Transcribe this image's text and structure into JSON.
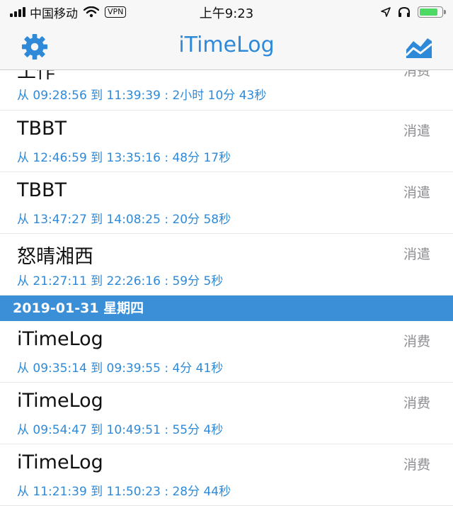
{
  "status_bar": {
    "carrier": "中国移动",
    "vpn": "VPN",
    "time": "上午9:23",
    "battery_level": 0.9,
    "battery_color": "#4cd964"
  },
  "nav": {
    "title": "iTimeLog",
    "left_icon": "gear-icon",
    "right_icon": "chart-icon",
    "accent": "#2e8ad8"
  },
  "rows_before": [
    {
      "title": "工作",
      "category": "消费",
      "time": "从 09:28:56  到 11:39:39 : 2小时 10分 43秒"
    },
    {
      "title": "TBBT",
      "category": "消遣",
      "time": "从 12:46:59  到 13:35:16 :  48分 17秒"
    },
    {
      "title": "TBBT",
      "category": "消遣",
      "time": "从 13:47:27  到 14:08:25 :  20分 58秒"
    },
    {
      "title": "怒晴湘西",
      "category": "消遣",
      "time": "从 21:27:11  到 22:26:16 :  59分 5秒"
    }
  ],
  "section": {
    "label": "2019-01-31 星期四"
  },
  "rows_after": [
    {
      "title": "iTimeLog",
      "category": "消费",
      "time": "从 09:35:14  到 09:39:55 :  4分 41秒"
    },
    {
      "title": "iTimeLog",
      "category": "消费",
      "time": "从 09:54:47  到 10:49:51 :  55分 4秒"
    },
    {
      "title": "iTimeLog",
      "category": "消费",
      "time": "从 11:21:39  到 11:50:23 :  28分 44秒"
    }
  ]
}
